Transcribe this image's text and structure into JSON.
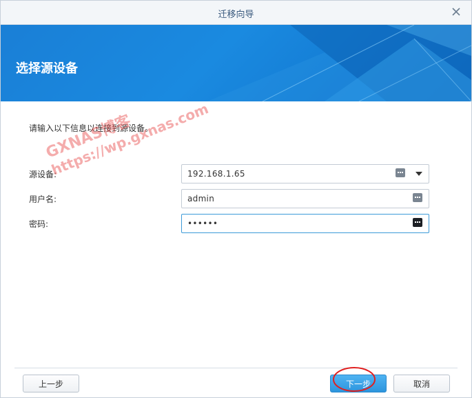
{
  "window": {
    "title": "迁移向导",
    "close_icon": "close-x-icon"
  },
  "banner": {
    "heading": "选择源设备"
  },
  "instructions": "请输入以下信息以连接到源设备。",
  "form": {
    "source_device": {
      "label": "源设备:",
      "value": "192.168.1.65",
      "icons": [
        "credential-menu-icon",
        "dropdown-arrow-icon"
      ]
    },
    "username": {
      "label": "用户名:",
      "value": "admin",
      "icons": [
        "credential-menu-icon"
      ]
    },
    "password": {
      "label": "密码:",
      "value": "••••••",
      "icons": [
        "credential-menu-icon"
      ]
    }
  },
  "watermark": {
    "line1": "GXNAS博客",
    "line2": "https://wp.gxnas.com"
  },
  "footer": {
    "prev_label": "上一步",
    "next_label": "下一步",
    "cancel_label": "取消"
  },
  "colors": {
    "banner": "#1a7fd6",
    "primary_button": "#2d95dd",
    "annotation": "#e02020",
    "watermark": "#e64646"
  }
}
